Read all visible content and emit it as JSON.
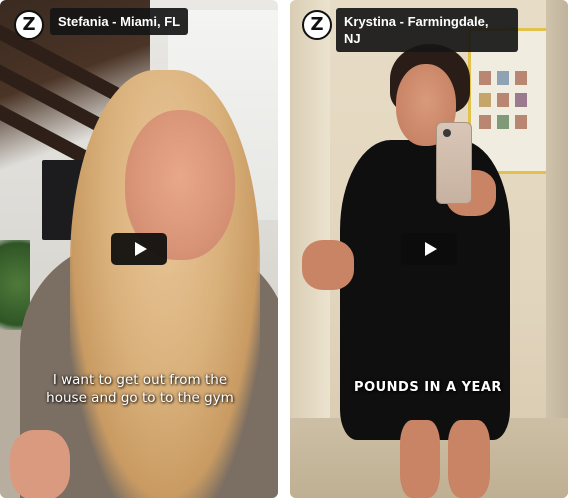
{
  "cards": [
    {
      "logo_letter": "Z",
      "name_label": "Stefania - Miami, FL",
      "caption": "I want to get out from the\nhouse and go to to the gym"
    },
    {
      "logo_letter": "Z",
      "name_label_line1": "Krystina - Farmingdale,",
      "name_label_line2": "NJ",
      "caption": "POUNDS IN A YEAR"
    }
  ],
  "icons": {
    "logo": "brand-z-logo",
    "play": "play-icon"
  },
  "colors": {
    "tag_background": "#161616",
    "play_button_background": "#0c0c0c",
    "caption_text": "#ffffff"
  }
}
